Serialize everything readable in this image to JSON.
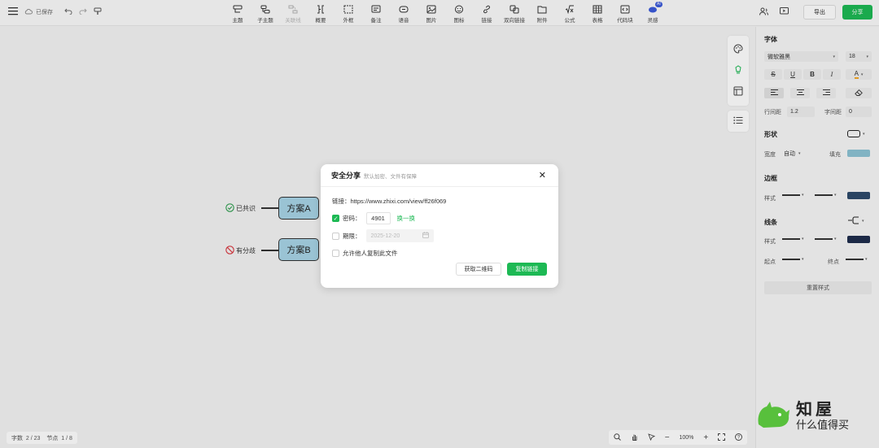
{
  "toolbar": {
    "save_status": "已保存",
    "tools": [
      {
        "name": "topic",
        "label": "主题",
        "icon": "topic-icon"
      },
      {
        "name": "subtopic",
        "label": "子主题",
        "icon": "subtopic-icon"
      },
      {
        "name": "relation",
        "label": "关联线",
        "icon": "relation-icon",
        "disabled": true
      },
      {
        "name": "summary",
        "label": "概要",
        "icon": "summary-icon"
      },
      {
        "name": "boundary",
        "label": "外框",
        "icon": "boundary-icon"
      },
      {
        "name": "note",
        "label": "备注",
        "icon": "note-icon"
      },
      {
        "name": "voice",
        "label": "语音",
        "icon": "voice-icon"
      },
      {
        "name": "image",
        "label": "图片",
        "icon": "image-icon"
      },
      {
        "name": "emoji",
        "label": "图标",
        "icon": "emoji-icon"
      },
      {
        "name": "link",
        "label": "链接",
        "icon": "link-icon"
      },
      {
        "name": "bilink",
        "label": "双向链接",
        "icon": "bilink-icon"
      },
      {
        "name": "attachment",
        "label": "附件",
        "icon": "attachment-icon"
      },
      {
        "name": "formula",
        "label": "公式",
        "icon": "formula-icon"
      },
      {
        "name": "table",
        "label": "表格",
        "icon": "table-icon"
      },
      {
        "name": "code",
        "label": "代码块",
        "icon": "code-icon"
      },
      {
        "name": "inspiration",
        "label": "灵感",
        "icon": "inspiration-icon",
        "badge": "AI"
      }
    ],
    "export_label": "导出",
    "share_label": "分享"
  },
  "canvas": {
    "node_a": "方案A",
    "node_b": "方案B",
    "tag_a": "已共识",
    "tag_b": "有分歧"
  },
  "panel": {
    "font_title": "字体",
    "font_family": "微软雅黑",
    "font_size": "18",
    "line_spacing_label": "行间距",
    "line_spacing": "1.2",
    "letter_spacing_label": "字间距",
    "letter_spacing": "0",
    "shape_title": "形状",
    "width_label": "宽度",
    "width_value": "自动",
    "fill_label": "填充",
    "fill_color": "#8cc3d4",
    "border_title": "边框",
    "style_label": "样式",
    "border_color": "#2e4a6b",
    "line_title": "线条",
    "line_style_label": "样式",
    "line_color": "#1f2d4d",
    "start_label": "起点",
    "end_label": "终点",
    "reset_label": "重置样式"
  },
  "status": {
    "words_label": "字数",
    "words_value": "2 / 23",
    "nodes_label": "节点",
    "nodes_value": "1 / 8"
  },
  "zoom": {
    "value": "100%"
  },
  "modal": {
    "title": "安全分享",
    "subtitle": "默认加密、文件有保障",
    "link_text": "链接：https://www.zhixi.com/view/ff26f069",
    "password_label": "密码：",
    "password_value": "4901",
    "change_label": "换一换",
    "expiry_label": "期限：",
    "expiry_placeholder": "2025-12-20",
    "allow_copy_label": "允许他人复制此文件",
    "qr_label": "获取二维码",
    "copy_label": "复制链接"
  },
  "watermark": {
    "big": "知屋",
    "small": "什么值得买"
  }
}
